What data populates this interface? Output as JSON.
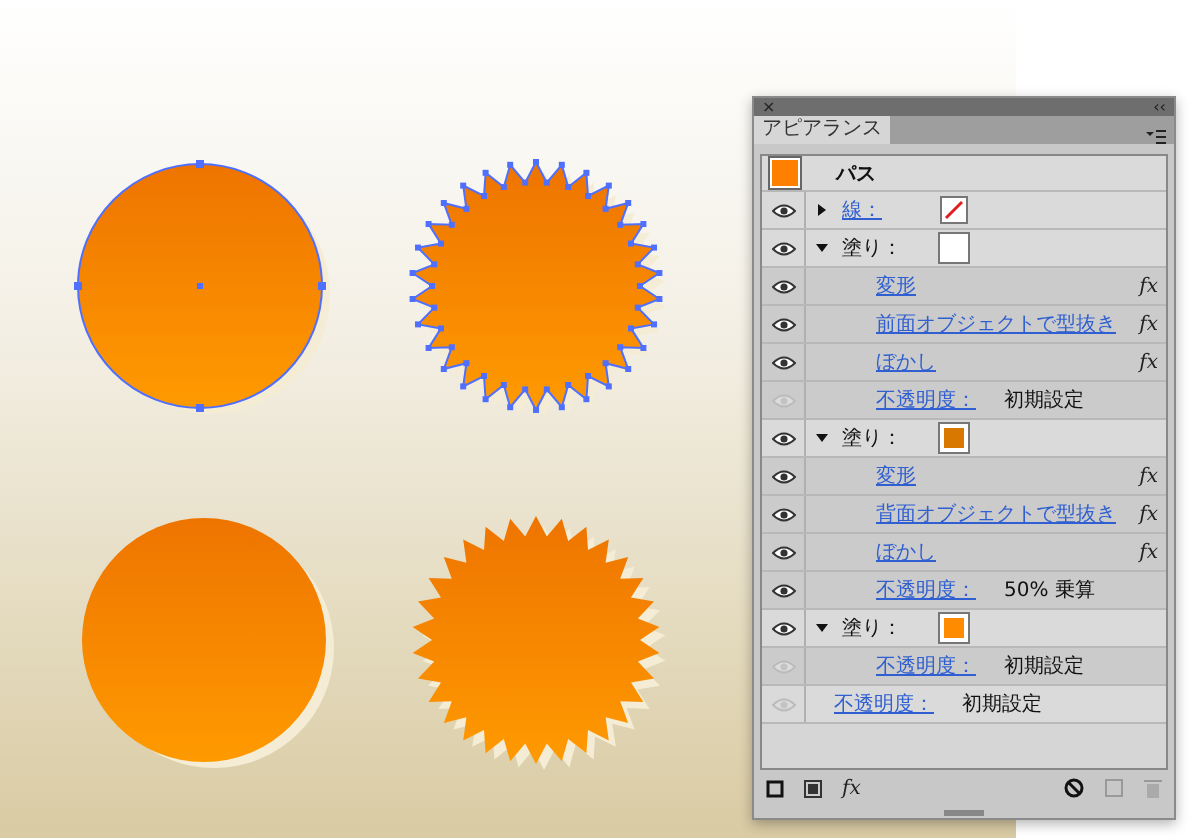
{
  "panel": {
    "close": "×",
    "collapse": "‹‹",
    "tab": {
      "label": "アピアランス",
      "selected": true
    },
    "object": {
      "label": "パス",
      "color": "#ff7f00"
    },
    "rows": [
      {
        "kind": "attribute",
        "label": "線：",
        "visible": true,
        "expanded": false,
        "no_color": true
      },
      {
        "kind": "attribute",
        "label": "塗り：",
        "visible": true,
        "expanded": true,
        "color": "#ffffff",
        "children": [
          {
            "kind": "effect",
            "label": "変形",
            "visible": true,
            "fx": "fx"
          },
          {
            "kind": "effect",
            "label": "前面オブジェクトで型抜き",
            "visible": true,
            "fx": "fx"
          },
          {
            "kind": "effect",
            "label": "ぼかし",
            "visible": true,
            "fx": "fx"
          },
          {
            "kind": "opacity",
            "label": "不透明度：",
            "value": "初期設定",
            "visible": false
          }
        ]
      },
      {
        "kind": "attribute",
        "label": "塗り：",
        "visible": true,
        "expanded": true,
        "color": "#d97800",
        "children": [
          {
            "kind": "effect",
            "label": "変形",
            "visible": true,
            "fx": "fx"
          },
          {
            "kind": "effect",
            "label": "背面オブジェクトで型抜き",
            "visible": true,
            "fx": "fx"
          },
          {
            "kind": "effect",
            "label": "ぼかし",
            "visible": true,
            "fx": "fx"
          },
          {
            "kind": "opacity",
            "label": "不透明度：",
            "value": "50% 乗算",
            "visible": true
          }
        ]
      },
      {
        "kind": "attribute",
        "label": "塗り：",
        "visible": true,
        "expanded": true,
        "color": "#ff8c00",
        "children": [
          {
            "kind": "opacity",
            "label": "不透明度：",
            "value": "初期設定",
            "visible": false
          }
        ]
      },
      {
        "kind": "opacity",
        "label": "不透明度：",
        "value": "初期設定",
        "visible": false
      }
    ],
    "toolbar": {
      "fx": "fx"
    }
  },
  "artwork": [
    {
      "kind": "circle",
      "selected": true
    },
    {
      "kind": "star",
      "selected": true
    },
    {
      "kind": "circle",
      "selected": false
    },
    {
      "kind": "star",
      "selected": false
    }
  ]
}
